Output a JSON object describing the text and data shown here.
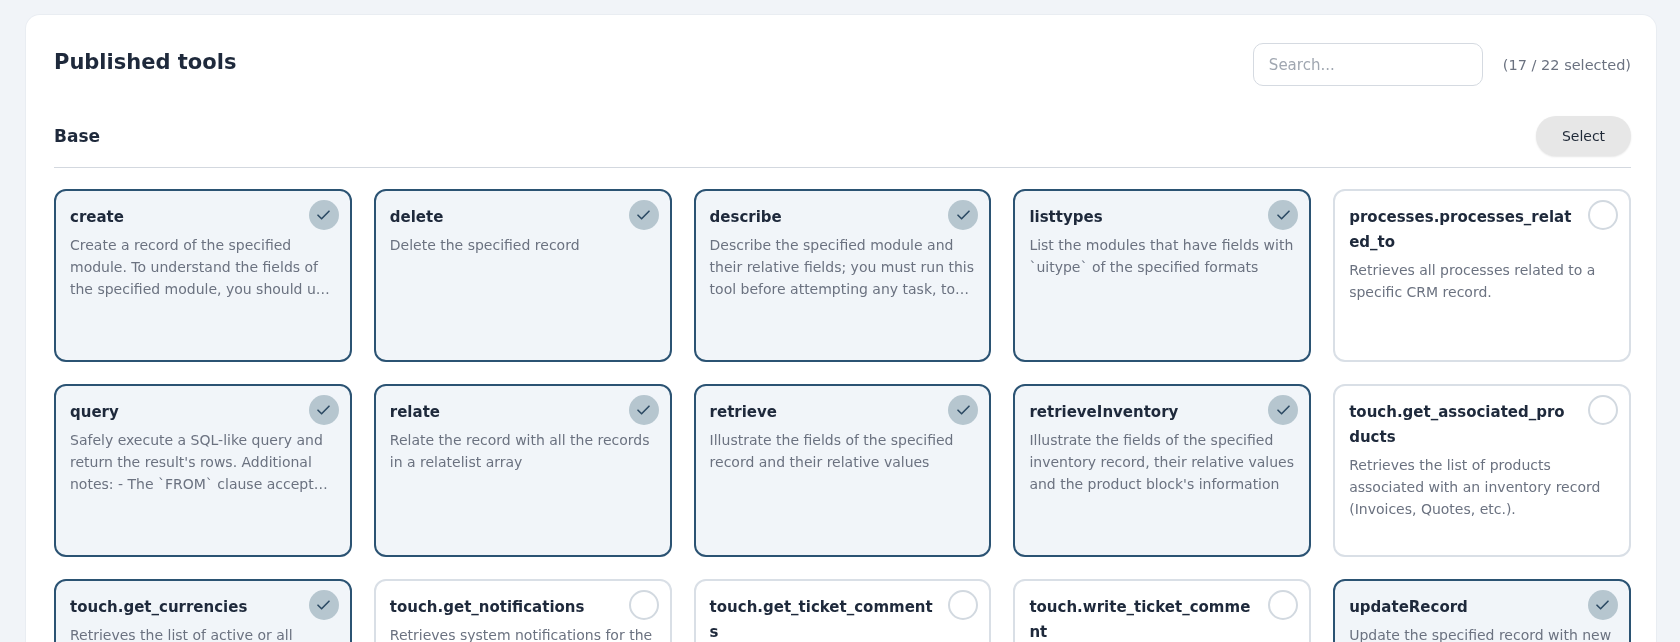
{
  "header": {
    "title": "Published tools",
    "search": {
      "placeholder": "Search..."
    },
    "selection_count": "(17 / 22 selected)"
  },
  "sections": [
    {
      "title": "Base",
      "button": "Select",
      "tools": [
        {
          "name": "create",
          "description": "Create a record of the specified module. To understand the fields of the specified module, you should u…",
          "selected": true
        },
        {
          "name": "delete",
          "description": "Delete the specified record",
          "selected": true
        },
        {
          "name": "describe",
          "description": "Describe the specified module and their relative fields; you must run this tool before attempting any task, to…",
          "selected": true
        },
        {
          "name": "listtypes",
          "description": "List the modules that have fields with `uitype` of the specified formats",
          "selected": true
        },
        {
          "name": "processes.processes_related_to",
          "description": "Retrieves all processes related to a specific CRM record.",
          "selected": false
        },
        {
          "name": "query",
          "description": "Safely execute a SQL-like query and return the result's rows. Additional notes: - The `FROM` clause accept…",
          "selected": true
        },
        {
          "name": "relate",
          "description": "Relate the record with all the records in a relatelist array",
          "selected": true
        },
        {
          "name": "retrieve",
          "description": "Illustrate the fields of the specified record and their relative values",
          "selected": true
        },
        {
          "name": "retrieveInventory",
          "description": "Illustrate the fields of the specified inventory record, their relative values and the product block's information",
          "selected": true
        },
        {
          "name": "touch.get_associated_products",
          "description": "Retrieves the list of products associated with an inventory record (Invoices, Quotes, etc.).",
          "selected": false
        },
        {
          "name": "touch.get_currencies",
          "description": "Retrieves the list of active or all",
          "selected": true
        },
        {
          "name": "touch.get_notifications",
          "description": "Retrieves system notifications for the",
          "selected": false
        },
        {
          "name": "touch.get_ticket_comments",
          "selected": false
        },
        {
          "name": "touch.write_ticket_comment",
          "selected": false
        },
        {
          "name": "updateRecord",
          "description": "Update the specified record with new",
          "selected": true
        }
      ]
    }
  ]
}
